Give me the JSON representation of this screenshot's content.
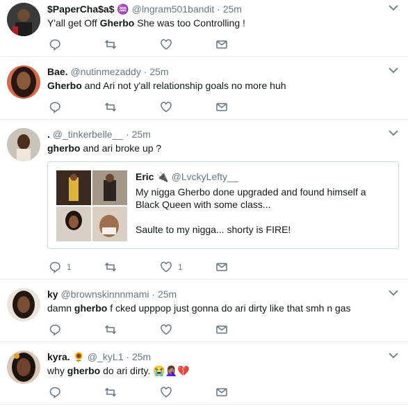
{
  "tweets": [
    {
      "name": "$PaperCha$a$",
      "name_emoji": "♒",
      "handle": "@lngram501bandit",
      "sep": "·",
      "time": "25m",
      "text_parts": [
        "Y'all get Off ",
        "Gherbo",
        " She was too Controlling !"
      ],
      "actions": {
        "reply": "",
        "retweet": "",
        "like": ""
      }
    },
    {
      "name": "Bae.",
      "handle": "@nutinmezaddy",
      "sep": "·",
      "time": "25m",
      "text_parts": [
        "Gherbo",
        " and Ari not y'all relationship goals no more huh"
      ]
    },
    {
      "name": ".",
      "handle": "@_tinkerbelle__",
      "sep": "·",
      "time": "25m",
      "text_parts": [
        "gherbo",
        " and ari broke up ?"
      ],
      "reply_count": "1",
      "like_count": "1",
      "quote": {
        "name": "Eric",
        "name_emoji": "🔌",
        "handle": "@LvckyLefty__",
        "text": "My nigga Gherbo done upgraded and found himself a\nBlack Queen with some class...\n\nSaulte to my nigga... shorty is FIRE!"
      }
    },
    {
      "name": "ky",
      "handle": "@brownskinnnmami",
      "sep": "·",
      "time": "25m",
      "text_parts": [
        "damn ",
        "gherbo",
        " f  cked upppop just gonna do ari dirty like that smh n  gas"
      ]
    },
    {
      "name": "kyra.",
      "name_emoji": "🌻",
      "handle": "@_kyL1",
      "sep": "·",
      "time": "25m",
      "text_parts": [
        "why ",
        "gherbo",
        " do ari dirty. "
      ],
      "text_emoji": "😭🤦🏽‍♀️💔"
    }
  ],
  "colors": {
    "text": "#14171a",
    "muted": "#657786",
    "border": "#e6ecf0"
  }
}
